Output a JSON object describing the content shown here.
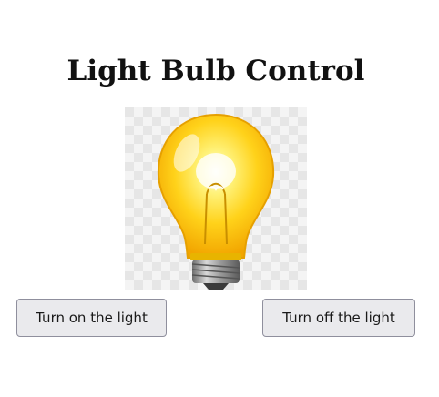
{
  "page": {
    "title": "Light Bulb Control"
  },
  "bulb": {
    "icon": "light-bulb-on",
    "state": "on",
    "glass_color": "#ffd21a",
    "base_color": "#9a9a9a"
  },
  "controls": {
    "on_label": "Turn on the light",
    "off_label": "Turn off the light"
  }
}
